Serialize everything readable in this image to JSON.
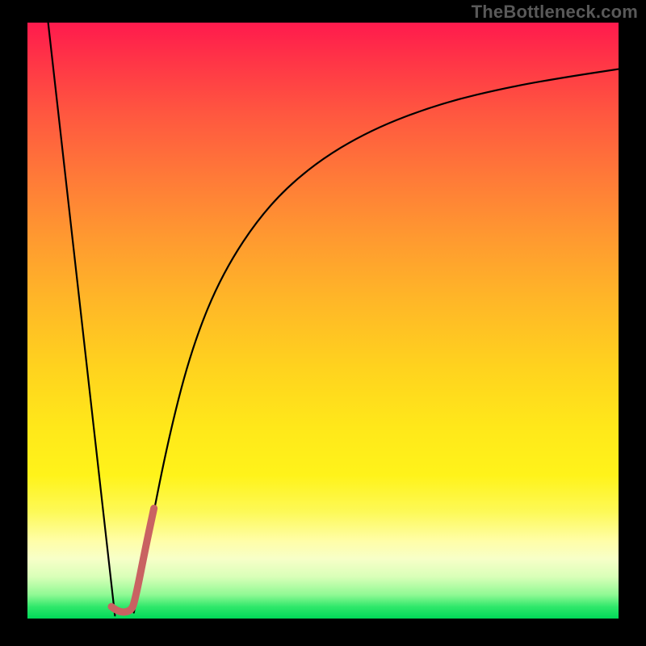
{
  "watermark_text": "TheBottleneck.com",
  "chart_data": {
    "type": "line",
    "title": "",
    "xlabel": "",
    "ylabel": "",
    "xlim": [
      0,
      100
    ],
    "ylim": [
      0,
      100
    ],
    "background_gradient_stops": [
      {
        "pct": 0,
        "color": "#ff1a4d"
      },
      {
        "pct": 50,
        "color": "#ffd31e"
      },
      {
        "pct": 100,
        "color": "#00d858"
      }
    ],
    "series": [
      {
        "name": "left-fall-line",
        "color": "#000000",
        "width": 2.2,
        "points_xy": [
          [
            3.5,
            100
          ],
          [
            14.8,
            0.5
          ]
        ]
      },
      {
        "name": "right-log-curve",
        "color": "#000000",
        "width": 2.2,
        "points_xy": [
          [
            18.0,
            1.0
          ],
          [
            20.0,
            11.0
          ],
          [
            24.0,
            31.0
          ],
          [
            28.0,
            46.0
          ],
          [
            33.0,
            58.0
          ],
          [
            40.0,
            68.5
          ],
          [
            48.0,
            76.0
          ],
          [
            58.0,
            82.0
          ],
          [
            70.0,
            86.5
          ],
          [
            82.0,
            89.3
          ],
          [
            92.0,
            91.0
          ],
          [
            100.0,
            92.2
          ]
        ]
      },
      {
        "name": "marker-J-stroke",
        "color": "#c96262",
        "width": 9,
        "points_xy": [
          [
            14.2,
            2.0
          ],
          [
            15.4,
            1.0
          ],
          [
            17.5,
            1.2
          ],
          [
            18.2,
            3.0
          ],
          [
            20.0,
            12.0
          ],
          [
            21.4,
            18.5
          ]
        ]
      }
    ]
  }
}
